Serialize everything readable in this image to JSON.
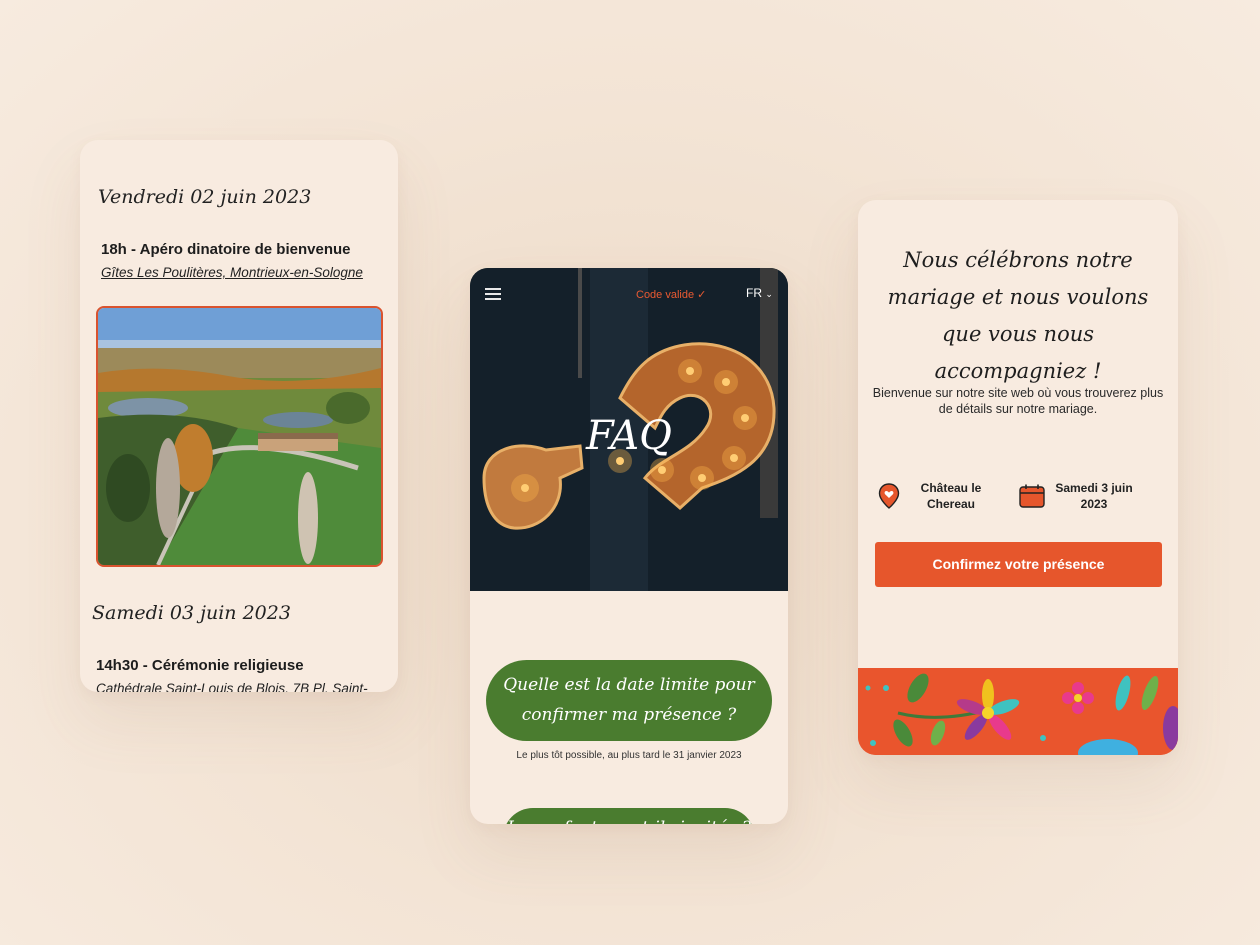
{
  "schedule": {
    "day1": "Vendredi 02 juin 2023",
    "event1_title": "18h - Apéro dinatoire de bienvenue",
    "event1_place": "Gîtes Les Poulitères, Montrieux-en-Sologne",
    "day2": "Samedi 03 juin 2023",
    "event2_title": "14h30 - Cérémonie religieuse",
    "event2_place": "Cathédrale Saint-Louis de Blois, 7B Pl. Saint-"
  },
  "faq_page": {
    "menu_icon": "hamburger-menu-icon",
    "code_status": "Code valide ✓",
    "language": "FR",
    "title": "FAQ",
    "question1": "Quelle est la date limite pour confirmer ma présence ?",
    "answer1": "Le plus tôt possible, au plus tard le 31 janvier 2023",
    "question2": "Les enfants sont-ils invités ?"
  },
  "home_page": {
    "headline": "Nous célébrons notre mariage et nous voulons que vous nous accompagniez !",
    "intro": "Bienvenue sur notre site web où vous trouverez plus de détails sur notre mariage.",
    "venue": "Château le Chereau",
    "venue_icon": "location-pin-icon",
    "date": "Samedi 3 juin 2023",
    "date_icon": "calendar-icon",
    "cta": "Confirmez votre présence"
  },
  "colors": {
    "accent_orange": "#e6562c",
    "faq_green": "#4a7c2f",
    "card_background": "#f8ebe0",
    "page_background": "#f4e6d8"
  }
}
